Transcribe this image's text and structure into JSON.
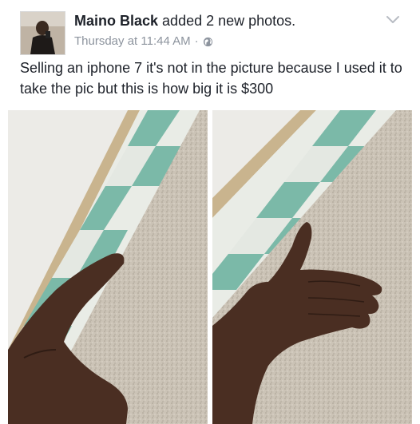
{
  "post": {
    "author": "Maino Black",
    "action": "added 2 new photos.",
    "timestamp": "Thursday at 11:44 AM",
    "separator": "·",
    "privacy_icon": "globe-icon",
    "menu_icon": "chevron-down-icon",
    "message": "Selling an iphone 7 it's not in the picture because I used it to take the pic but this is how big it is $300"
  },
  "colors": {
    "author": "#1d2129",
    "meta": "#8d949e",
    "tile_green": "#7bb9a8",
    "tile_white": "#e9ece6",
    "carpet": "#c8c0b4",
    "skin": "#4a2e22"
  }
}
